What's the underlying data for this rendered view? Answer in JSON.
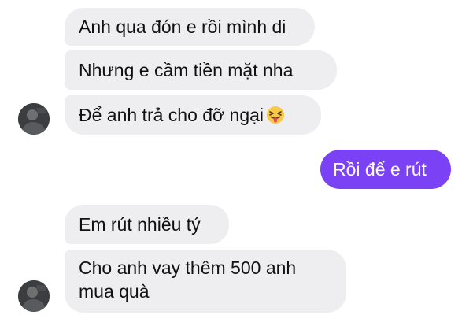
{
  "chat": {
    "messages": [
      {
        "id": "m1",
        "sender": "incoming",
        "text": "Anh qua đón e rồi mình di"
      },
      {
        "id": "m2",
        "sender": "incoming",
        "text": "Nhưng e cầm tiền mặt nha"
      },
      {
        "id": "m3",
        "sender": "incoming",
        "text": "Để anh trả cho đỡ ngại",
        "emoji": "squinting-tongue-emoji"
      },
      {
        "id": "m4",
        "sender": "outgoing",
        "text": "Rồi để e rút"
      },
      {
        "id": "m5",
        "sender": "incoming",
        "text": "Em rút nhiều tý"
      },
      {
        "id": "m6",
        "sender": "incoming",
        "lines": [
          "Cho anh vay thêm 500 anh",
          "mua quà"
        ]
      }
    ]
  },
  "colors": {
    "incoming_bubble": "#eeeef0",
    "outgoing_bubble": "#7a42f4",
    "incoming_text": "#111111",
    "outgoing_text": "#ffffff"
  },
  "icons": {
    "avatar": "sender-avatar",
    "emoji": "squinting-face-with-tongue"
  }
}
